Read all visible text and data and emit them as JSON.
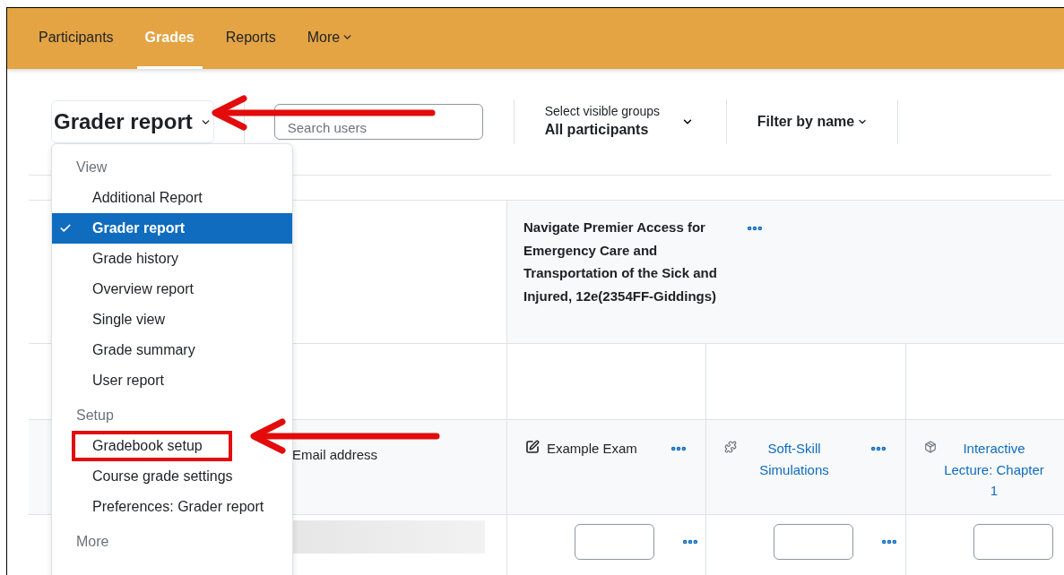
{
  "nav": {
    "tabs": [
      {
        "label": "Participants",
        "selected": false,
        "dropdown": false
      },
      {
        "label": "Grades",
        "selected": true,
        "dropdown": false
      },
      {
        "label": "Reports",
        "selected": false,
        "dropdown": false
      },
      {
        "label": "More",
        "selected": false,
        "dropdown": true
      }
    ]
  },
  "toolbar": {
    "report_selector": "Grader report",
    "search": {
      "placeholder": "Search users"
    },
    "groups": {
      "label": "Select visible groups",
      "value": "All participants"
    },
    "filter": "Filter by name"
  },
  "report_menu": {
    "sections": [
      {
        "heading": "View",
        "items": [
          {
            "label": "Additional Report",
            "selected": false,
            "highlighted": false
          },
          {
            "label": "Grader report",
            "selected": true,
            "highlighted": false
          },
          {
            "label": "Grade history",
            "selected": false,
            "highlighted": false
          },
          {
            "label": "Overview report",
            "selected": false,
            "highlighted": false
          },
          {
            "label": "Single view",
            "selected": false,
            "highlighted": false
          },
          {
            "label": "Grade summary",
            "selected": false,
            "highlighted": false
          },
          {
            "label": "User report",
            "selected": false,
            "highlighted": false
          }
        ]
      },
      {
        "heading": "Setup",
        "items": [
          {
            "label": "Gradebook setup",
            "selected": false,
            "highlighted": true
          },
          {
            "label": "Course grade settings",
            "selected": false,
            "highlighted": false
          },
          {
            "label": "Preferences: Grader report",
            "selected": false,
            "highlighted": false
          }
        ]
      },
      {
        "heading": "More"
      }
    ]
  },
  "grade_table": {
    "category": "Navigate Premier Access for Emergency Care and Transportation of the Sick and Injured, 12e(2354FF-Giddings)",
    "user_column": "Email address",
    "items": [
      {
        "name": "Example Exam",
        "kind": "exam",
        "link": false,
        "menu": true
      },
      {
        "name": "Soft-Skill Simulations",
        "kind": "simulation",
        "link": true,
        "menu": true
      },
      {
        "name": "Interactive Lecture: Chapter 1",
        "kind": "lecture",
        "link": true,
        "menu": false
      }
    ]
  }
}
